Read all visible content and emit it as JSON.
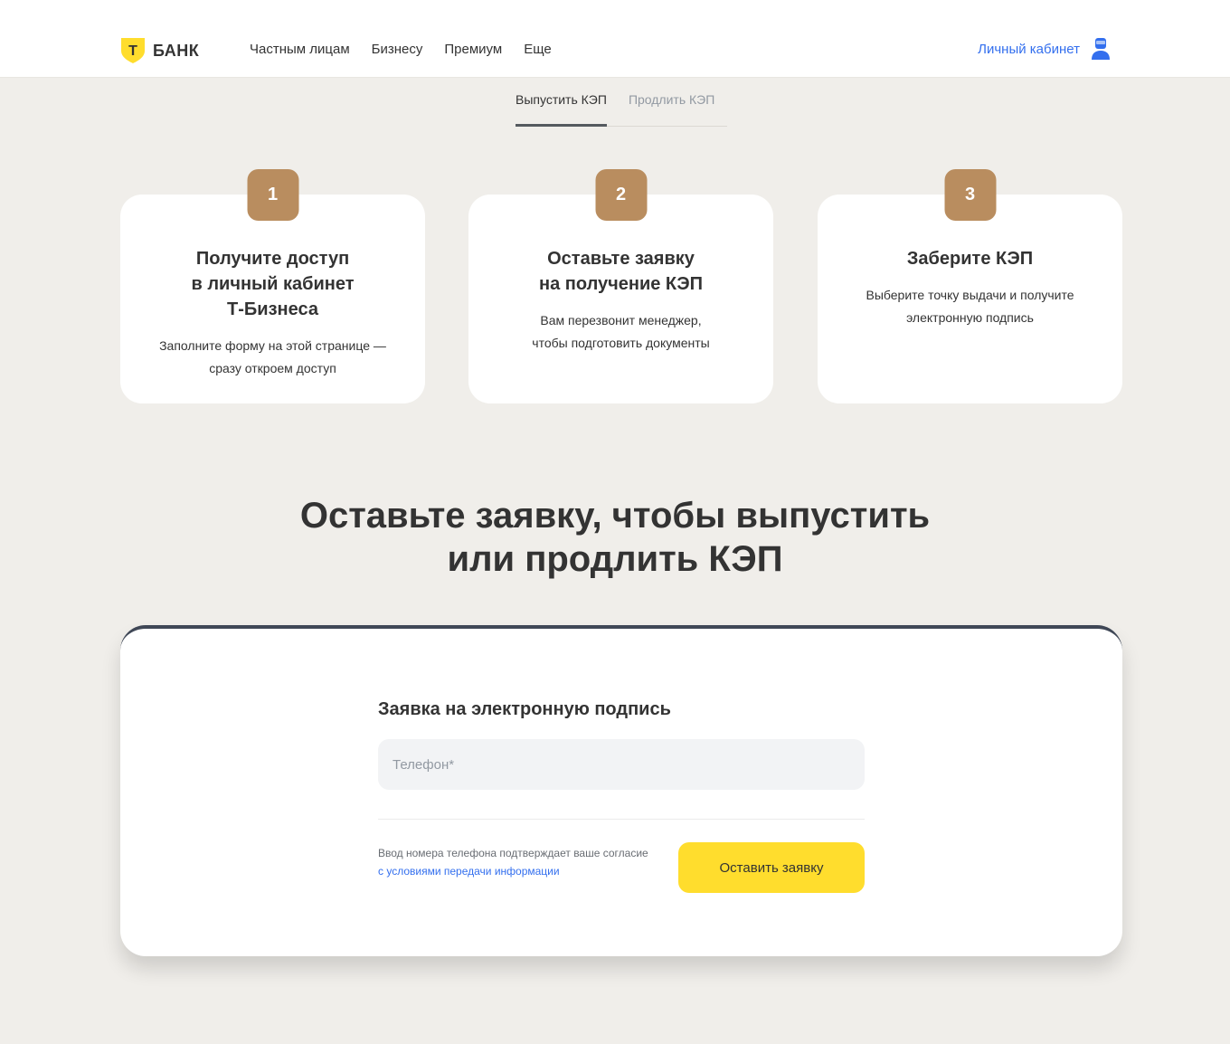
{
  "header": {
    "logo_text": "БАНК",
    "logo_mark": "Т",
    "nav": [
      "Частным лицам",
      "Бизнесу",
      "Премиум",
      "Еще"
    ],
    "account_label": "Личный кабинет"
  },
  "tabs": [
    {
      "label": "Выпустить КЭП",
      "active": true
    },
    {
      "label": "Продлить КЭП",
      "active": false
    }
  ],
  "steps": [
    {
      "number": "1",
      "title": "Получите доступ\nв личный кабинет\nТ-Бизнеса",
      "text": "Заполните форму на этой странице —\nсразу откроем доступ"
    },
    {
      "number": "2",
      "title": "Оставьте заявку\nна получение КЭП",
      "text": "Вам перезвонит менеджер,\nчтобы подготовить документы"
    },
    {
      "number": "3",
      "title": "Заберите КЭП",
      "text": "Выберите точку выдачи и получите\nэлектронную подпись"
    }
  ],
  "main_heading": "Оставьте заявку, чтобы выпустить\nили продлить КЭП",
  "form": {
    "title": "Заявка на электронную подпись",
    "phone_placeholder": "Телефон*",
    "phone_value": "",
    "consent_text": "Ввод номера телефона подтверждает ваше согласие ",
    "consent_link": "с условиями передачи информации",
    "submit_label": "Оставить заявку"
  },
  "colors": {
    "background": "#f0eeea",
    "accent_yellow": "#ffdd2d",
    "step_badge": "#b98d5f",
    "link_blue": "#336fee",
    "card_top_border": "#3f4756"
  },
  "icons": {
    "logo": "t-bank-shield-icon",
    "account": "user-icon"
  }
}
